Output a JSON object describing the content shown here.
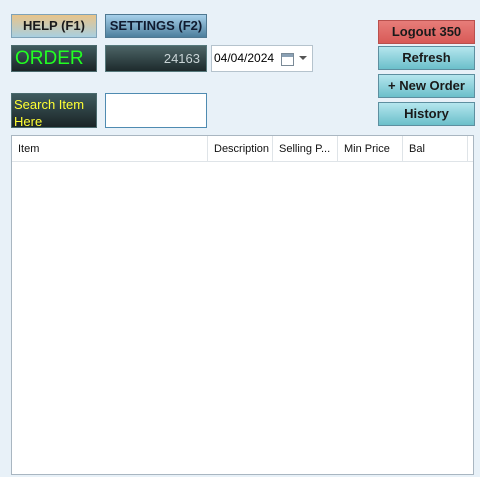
{
  "header": {
    "help_label": "HELP (F1)",
    "settings_label": "SETTINGS (F2)"
  },
  "order": {
    "label": "ORDER",
    "number": "24163",
    "date": "04/04/2024"
  },
  "search": {
    "label": "Search Item Here",
    "value": ""
  },
  "actions": {
    "logout_label": "Logout 350",
    "refresh_label": "Refresh",
    "new_order_label": "+ New Order",
    "history_label": "History"
  },
  "table": {
    "columns": [
      "Item",
      "Description",
      "Selling P...",
      "Min Price",
      "Bal"
    ],
    "rows": []
  },
  "colors": {
    "order_text": "#22ff22",
    "search_label_text": "#ffff33",
    "logout_bg": "#e06c69",
    "action_bg": "#8fd3dc"
  }
}
